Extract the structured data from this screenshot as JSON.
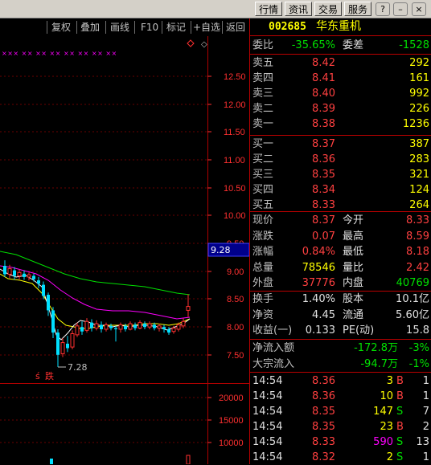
{
  "top_tabs": [
    "行情",
    "资讯",
    "交易",
    "服务"
  ],
  "window_controls": {
    "help": "?",
    "minimize": "–",
    "close": "×"
  },
  "chart_toolbar": [
    "复权",
    "叠加",
    "画线",
    "F10",
    "标记",
    "+自选",
    "返回"
  ],
  "chart": {
    "price_ticks": [
      "12.50",
      "12.00",
      "11.50",
      "11.00",
      "10.50",
      "10.00",
      "9.50",
      "9.00",
      "8.50",
      "8.00",
      "7.50"
    ],
    "current_price_tag": "9.28",
    "low_annotation": "7.28",
    "event_marks": [
      "ś",
      "跌"
    ],
    "volume_ticks": [
      "20000",
      "15000",
      "10000"
    ],
    "top_markers": "××× ×× ×× ×× ×× ×× ×× ××",
    "colors": {
      "up": "#ff3030",
      "down": "#00e0ff",
      "ma1": "#ffffff",
      "ma2": "#ffff00",
      "ma3": "#ff00ff",
      "ma4": "#00ff00",
      "axis": "#b00000"
    }
  },
  "quote": {
    "code": "002685",
    "name": "华东重机",
    "weibi_label": "委比",
    "weibi": "-35.65%",
    "weicha_label": "委差",
    "weicha": "-1528",
    "asks": [
      {
        "label": "卖五",
        "price": "8.42",
        "vol": "292"
      },
      {
        "label": "卖四",
        "price": "8.41",
        "vol": "161"
      },
      {
        "label": "卖三",
        "price": "8.40",
        "vol": "992"
      },
      {
        "label": "卖二",
        "price": "8.39",
        "vol": "226"
      },
      {
        "label": "卖一",
        "price": "8.38",
        "vol": "1236"
      }
    ],
    "bids": [
      {
        "label": "买一",
        "price": "8.37",
        "vol": "387"
      },
      {
        "label": "买二",
        "price": "8.36",
        "vol": "283"
      },
      {
        "label": "买三",
        "price": "8.35",
        "vol": "321"
      },
      {
        "label": "买四",
        "price": "8.34",
        "vol": "124"
      },
      {
        "label": "买五",
        "price": "8.33",
        "vol": "264"
      }
    ],
    "stats": [
      {
        "l1": "现价",
        "v1": "8.37",
        "l2": "今开",
        "v2": "8.33"
      },
      {
        "l1": "涨跌",
        "v1": "0.07",
        "l2": "最高",
        "v2": "8.59"
      },
      {
        "l1": "涨幅",
        "v1": "0.84%",
        "l2": "最低",
        "v2": "8.18"
      },
      {
        "l1": "总量",
        "v1": "78546",
        "l2": "量比",
        "v2": "2.42"
      },
      {
        "l1": "外盘",
        "v1": "37776",
        "l2": "内盘",
        "v2": "40769"
      }
    ],
    "fund": [
      {
        "l1": "换手",
        "v1": "1.40%",
        "l2": "股本",
        "v2": "10.1亿"
      },
      {
        "l1": "净资",
        "v1": "4.45",
        "l2": "流通",
        "v2": "5.60亿"
      },
      {
        "l1": "收益(一)",
        "v1": "0.133",
        "l2": "PE(动)",
        "v2": "15.8"
      }
    ],
    "flows": [
      {
        "label": "净流入额",
        "value": "-172.8万",
        "pct": "-3%"
      },
      {
        "label": "大宗流入",
        "value": "-94.7万",
        "pct": "-1%"
      }
    ],
    "ticks": [
      {
        "time": "14:54",
        "price": "8.36",
        "vol": "3",
        "side": "B",
        "n": "1"
      },
      {
        "time": "14:54",
        "price": "8.36",
        "vol": "10",
        "side": "B",
        "n": "1"
      },
      {
        "time": "14:54",
        "price": "8.35",
        "vol": "147",
        "side": "S",
        "n": "7"
      },
      {
        "time": "14:54",
        "price": "8.35",
        "vol": "23",
        "side": "B",
        "n": "2"
      },
      {
        "time": "14:54",
        "price": "8.33",
        "vol": "590",
        "side": "S",
        "n": "13"
      },
      {
        "time": "14:54",
        "price": "8.32",
        "vol": "2",
        "side": "S",
        "n": "1"
      }
    ]
  }
}
